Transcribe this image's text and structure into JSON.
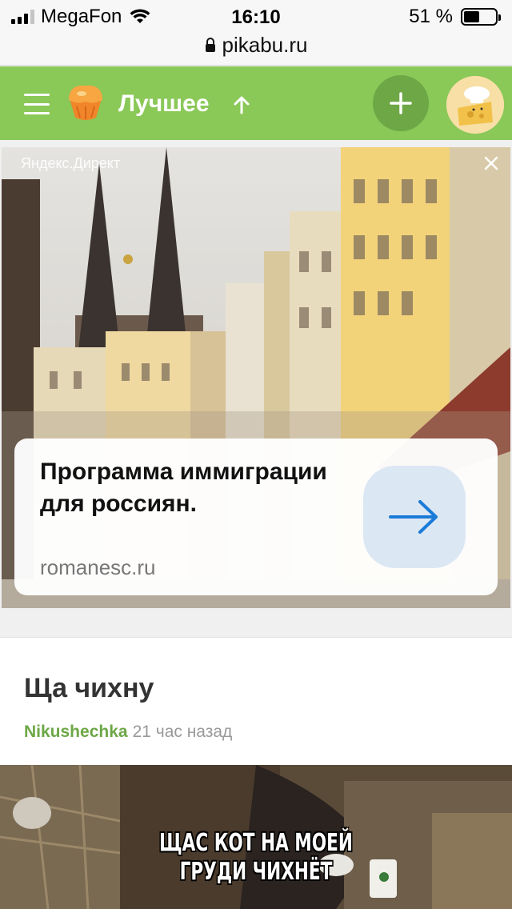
{
  "status_bar": {
    "carrier": "MegaFon",
    "time": "16:10",
    "battery": "51 %",
    "battery_level": 0.51,
    "url": "pikabu.ru"
  },
  "header": {
    "section_title": "Лучшее",
    "accent_color": "#8ac858"
  },
  "ad": {
    "source": "Яндекс.Директ",
    "title": "Программа иммиграции для россиян.",
    "domain": "romanesc.ru"
  },
  "post": {
    "title": "Ща чихну",
    "author": "Nikushechka",
    "time": "21 час назад",
    "image_caption_line1": "ЩАС КОТ НА МОЕЙ",
    "image_caption_line2": "ГРУДИ ЧИХНЁТ"
  },
  "colors": {
    "brand_green": "#8ac858",
    "author_green": "#6da746",
    "ad_arrow_blue": "#1a7bd8"
  },
  "icons": [
    "signal-icon",
    "wifi-icon",
    "battery-icon",
    "lock-icon",
    "menu-icon",
    "pikabu-logo-icon",
    "arrow-up-icon",
    "plus-icon",
    "close-icon",
    "arrow-right-icon"
  ]
}
